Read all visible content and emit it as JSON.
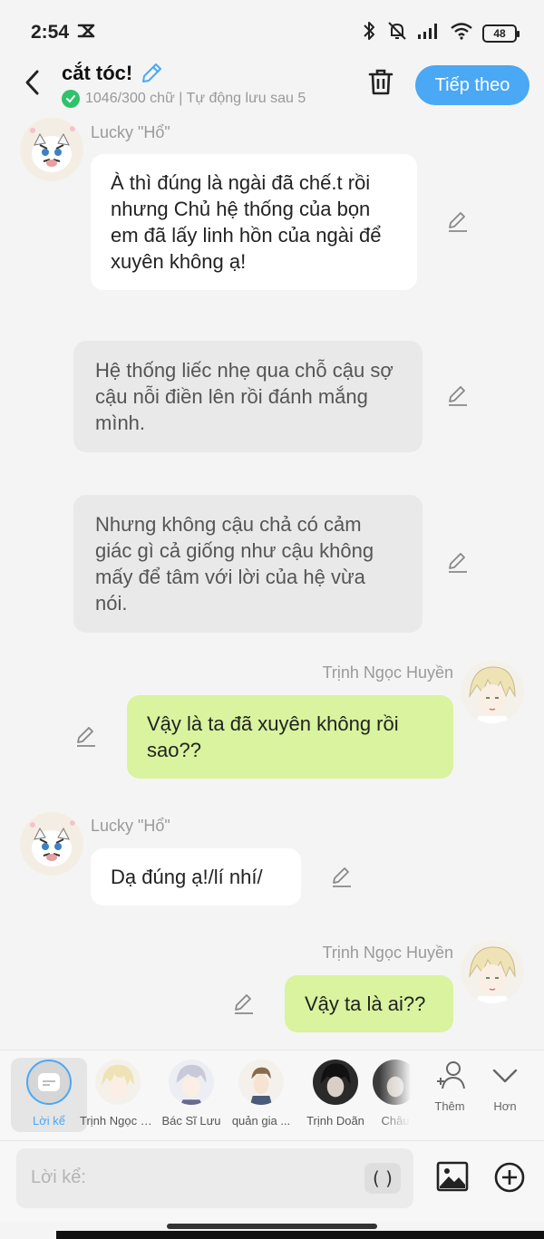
{
  "status_bar": {
    "time": "2:54",
    "battery": "48"
  },
  "header": {
    "title": "cắt tóc!",
    "subtitle": "1046/300 chữ | Tự động lưu sau 5",
    "next_label": "Tiếp theo"
  },
  "messages": [
    {
      "side": "left",
      "style": "white",
      "sender": "Lucky \"Hổ\"",
      "text": "À thì đúng là ngài đã chế.t rồi nhưng Chủ hệ thống của bọn em đã lấy linh hồn của ngài để xuyên không ạ!"
    },
    {
      "side": "left",
      "style": "gray",
      "sender": "",
      "text": "Hệ thống liếc nhẹ qua chỗ cậu sợ cậu nỗi điền lên rồi đánh mắng mình."
    },
    {
      "side": "left",
      "style": "gray",
      "sender": "",
      "text": "Nhưng không cậu chả có cảm giác gì cả giống như cậu không mấy để tâm với lời của hệ vừa nói."
    },
    {
      "side": "right",
      "style": "green",
      "sender": "Trịnh Ngọc Huyền",
      "text": "Vậy là ta đã xuyên không rồi sao??"
    },
    {
      "side": "left",
      "style": "white",
      "sender": "Lucky \"Hổ\"",
      "text": "Dạ đúng ạ!/lí nhí/"
    },
    {
      "side": "right",
      "style": "green",
      "sender": "Trịnh Ngọc Huyền",
      "text": "Vậy ta là ai??"
    }
  ],
  "characters": [
    {
      "label": "Lời kể",
      "active": true
    },
    {
      "label": "Trịnh Ngọc Huyền"
    },
    {
      "label": "Bác Sĩ Lưu"
    },
    {
      "label": "quản gia ..."
    },
    {
      "label": "Trịnh Doãn"
    },
    {
      "label": "Châu"
    }
  ],
  "tools": {
    "add_label": "Thêm",
    "more_label": "Hơn"
  },
  "input": {
    "placeholder": "Lời kể:",
    "paren_label": "( )"
  },
  "colors": {
    "accent": "#4aa8f5",
    "green_bubble": "#d9f39e",
    "white_bubble": "#ffffff",
    "gray_bubble": "#e9e9e9"
  }
}
